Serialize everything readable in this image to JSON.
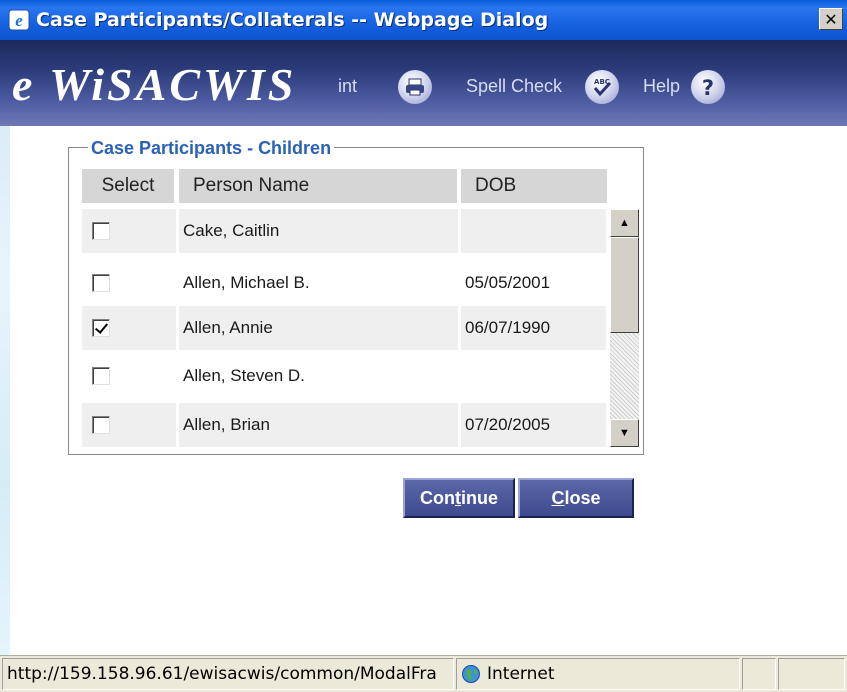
{
  "window": {
    "title": "Case Participants/Collaterals -- Webpage Dialog",
    "close_glyph": "✕",
    "icon": "ie-icon"
  },
  "header": {
    "logo": "e WiSACWIS",
    "print_label": "int",
    "spell_check_label": "Spell Check",
    "help_label": "Help",
    "icons": [
      "print-icon",
      "spell-check-icon",
      "help-icon"
    ]
  },
  "participants": {
    "legend": "Case Participants - Children",
    "columns": [
      "Select",
      "Person Name",
      "DOB"
    ],
    "rows": [
      {
        "name": "Cake, Caitlin",
        "dob": "",
        "checked": false
      },
      {
        "name": "Allen, Michael B.",
        "dob": "05/05/2001",
        "checked": false
      },
      {
        "name": "Allen, Annie",
        "dob": "06/07/1990",
        "checked": true
      },
      {
        "name": "Allen, Steven D.",
        "dob": "",
        "checked": false
      },
      {
        "name": "Allen, Brian",
        "dob": "07/20/2005",
        "checked": false
      }
    ]
  },
  "actions": {
    "continue_pre": "Con",
    "continue_u": "t",
    "continue_post": "inue",
    "close_u": "C",
    "close_post": "lose"
  },
  "statusbar": {
    "url": "http://159.158.96.61/ewisacwis/common/ModalFra",
    "zone": "Internet"
  }
}
